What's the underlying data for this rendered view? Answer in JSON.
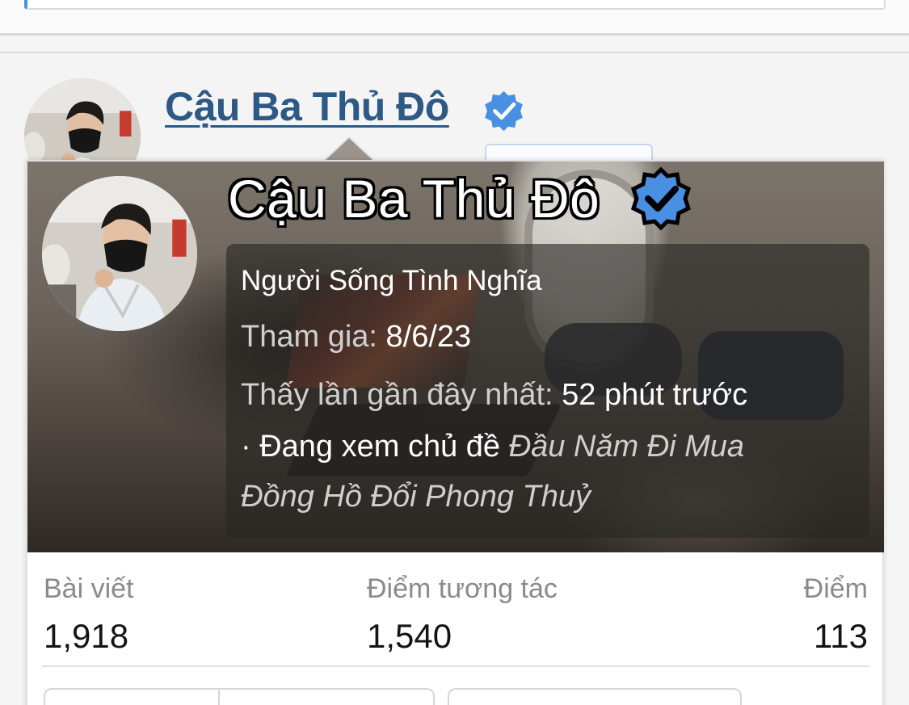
{
  "background_post": {
    "username": "Cậu Ba Thủ Đô",
    "verified": true
  },
  "member_card": {
    "username": "Cậu Ba Thủ Đô",
    "verified": true,
    "title": "Người Sống Tình Nghĩa",
    "joined_label": "Tham gia:",
    "joined_value": "8/6/23",
    "last_seen_label": "Thấy lần gần đây nhất:",
    "last_seen_value": "52 phút trước",
    "viewing_prefix": "· Đang xem chủ đề",
    "viewing_thread_line1": "Đầu Năm Đi Mua",
    "viewing_thread_line2": "Đồng Hồ Đổi Phong Thuỷ",
    "stats": [
      {
        "label": "Bài viết",
        "value": "1,918"
      },
      {
        "label": "Điểm tương tác",
        "value": "1,540"
      },
      {
        "label": "Điểm",
        "value": "113"
      }
    ]
  },
  "colors": {
    "link": "#2e5984",
    "verified": "#4a90e2",
    "stat_label": "#8a8a8a"
  },
  "icons": [
    "verified-badge-icon"
  ]
}
